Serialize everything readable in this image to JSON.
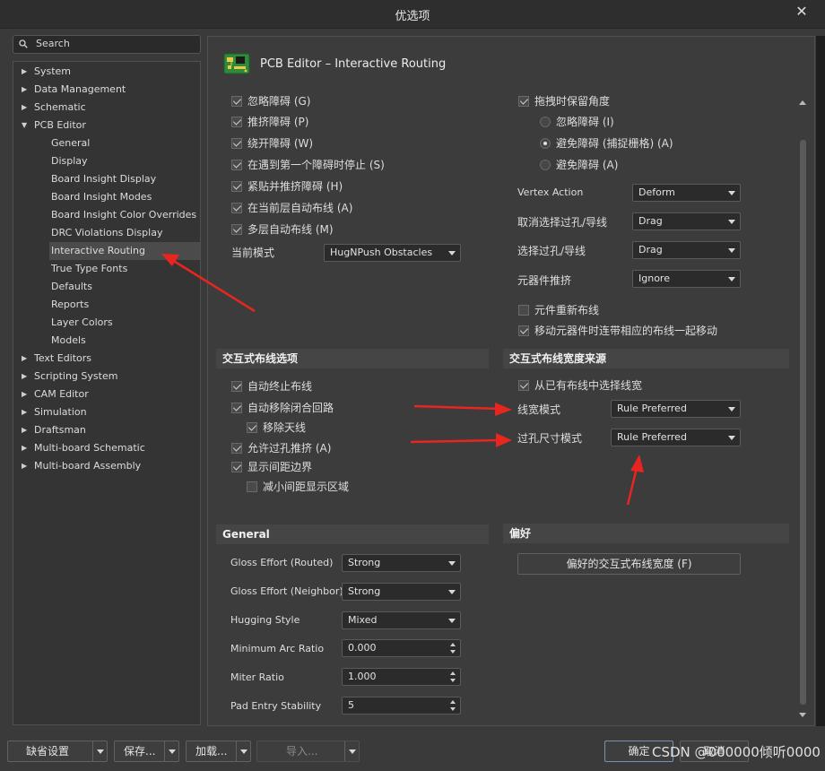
{
  "window": {
    "title": "优选项",
    "close_glyph": "✕"
  },
  "search": {
    "placeholder": "Search"
  },
  "tree": {
    "items": [
      {
        "label": "System",
        "expandable": true
      },
      {
        "label": "Data Management",
        "expandable": true
      },
      {
        "label": "Schematic",
        "expandable": true
      },
      {
        "label": "PCB Editor",
        "expanded": true
      },
      {
        "label": "General"
      },
      {
        "label": "Display"
      },
      {
        "label": "Board Insight Display"
      },
      {
        "label": "Board Insight Modes"
      },
      {
        "label": "Board Insight Color Overrides"
      },
      {
        "label": "DRC Violations Display"
      },
      {
        "label": "Interactive Routing",
        "selected": true
      },
      {
        "label": "True Type Fonts"
      },
      {
        "label": "Defaults"
      },
      {
        "label": "Reports"
      },
      {
        "label": "Layer Colors"
      },
      {
        "label": "Models"
      },
      {
        "label": "Text Editors",
        "expandable": true
      },
      {
        "label": "Scripting System",
        "expandable": true
      },
      {
        "label": "CAM Editor",
        "expandable": true
      },
      {
        "label": "Simulation",
        "expandable": true
      },
      {
        "label": "Draftsman",
        "expandable": true
      },
      {
        "label": "Multi-board Schematic",
        "expandable": true
      },
      {
        "label": "Multi-board Assembly",
        "expandable": true
      }
    ]
  },
  "page": {
    "heading": "PCB Editor – Interactive Routing"
  },
  "routing_conflict": {
    "options": [
      {
        "label": "忽略障碍 (G)",
        "checked": true
      },
      {
        "label": "推挤障碍 (P)",
        "checked": true
      },
      {
        "label": "绕开障碍 (W)",
        "checked": true
      },
      {
        "label": "在遇到第一个障碍时停止 (S)",
        "checked": true
      },
      {
        "label": "紧贴并推挤障碍 (H)",
        "checked": true
      },
      {
        "label": "在当前层自动布线 (A)",
        "checked": true
      },
      {
        "label": "多层自动布线 (M)",
        "checked": true
      }
    ],
    "current_mode_label": "当前模式",
    "current_mode_value": "HugNPush Obstacles"
  },
  "drag": {
    "keep_angle_label": "拖拽时保留角度",
    "keep_angle_checked": true,
    "radios": [
      {
        "label": "忽略障碍 (I)",
        "selected": false
      },
      {
        "label": "避免障碍 (捕捉栅格) (A)",
        "selected": true
      },
      {
        "label": "避免障碍 (A)",
        "selected": false
      }
    ],
    "vertex_action_label": "Vertex Action",
    "vertex_action_value": "Deform",
    "unselected_via_label": "取消选择过孔/导线",
    "unselected_via_value": "Drag",
    "selected_via_label": "选择过孔/导线",
    "selected_via_value": "Drag",
    "component_push_label": "元器件推挤",
    "component_push_value": "Ignore",
    "reroute_label": "元件重新布线",
    "reroute_checked": false,
    "move_with_traces_label": "移动元器件时连带相应的布线一起移动",
    "move_with_traces_checked": true
  },
  "interactive_options": {
    "title": "交互式布线选项",
    "items": [
      {
        "label": "自动终止布线",
        "checked": true,
        "indent": 0
      },
      {
        "label": "自动移除闭合回路",
        "checked": true,
        "indent": 0
      },
      {
        "label": "移除天线",
        "checked": true,
        "indent": 1
      },
      {
        "label": "允许过孔推挤 (A)",
        "checked": true,
        "indent": 0
      },
      {
        "label": "显示间距边界",
        "checked": true,
        "indent": 0
      },
      {
        "label": "减小间距显示区域",
        "checked": false,
        "indent": 1
      }
    ]
  },
  "width_source": {
    "title": "交互式布线宽度来源",
    "pick_existing_label": "从已有布线中选择线宽",
    "pick_existing_checked": true,
    "width_mode_label": "线宽模式",
    "width_mode_value": "Rule Preferred",
    "via_mode_label": "过孔尺寸模式",
    "via_mode_value": "Rule Preferred"
  },
  "general": {
    "title": "General",
    "gloss_routed_label": "Gloss Effort (Routed)",
    "gloss_routed_value": "Strong",
    "gloss_neighbor_label": "Gloss Effort (Neighbor)",
    "gloss_neighbor_value": "Strong",
    "hugging_label": "Hugging Style",
    "hugging_value": "Mixed",
    "min_arc_label": "Minimum Arc Ratio",
    "min_arc_value": "0.000",
    "miter_label": "Miter Ratio",
    "miter_value": "1.000",
    "pad_entry_label": "Pad Entry Stability",
    "pad_entry_value": "5"
  },
  "preferences": {
    "title": "偏好",
    "button_label": "偏好的交互式布线宽度 (F)"
  },
  "footer": {
    "default_label": "缺省设置",
    "save_label": "保存...",
    "load_label": "加载...",
    "import_label": "导入...",
    "ok_label": "确定",
    "cancel_label": "取消"
  },
  "watermark": "CSDN @000000倾听0000",
  "colors": {
    "background": "#3a3a3a",
    "panel": "#3c3c3c",
    "arrow": "#e8251f"
  }
}
